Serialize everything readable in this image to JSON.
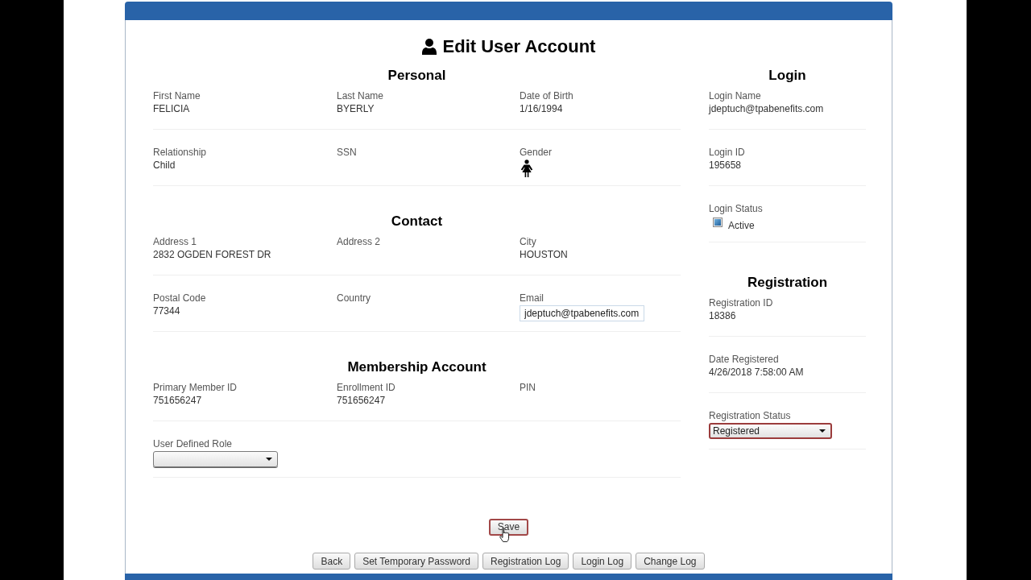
{
  "title": "Edit User Account",
  "main_sections": [
    {
      "heading": "Personal",
      "rows": [
        [
          {
            "label": "First Name",
            "kind": "text",
            "value": "FELICIA"
          },
          {
            "label": "Last Name",
            "kind": "text",
            "value": "BYERLY"
          },
          {
            "label": "Date of Birth",
            "kind": "text",
            "value": "1/16/1994"
          }
        ],
        [
          {
            "label": "Relationship",
            "kind": "text",
            "value": "Child"
          },
          {
            "label": "SSN",
            "kind": "text"
          },
          {
            "label": "Gender",
            "kind": "gender_icon"
          }
        ]
      ]
    },
    {
      "heading": "Contact",
      "rows": [
        [
          {
            "label": "Address 1",
            "kind": "text",
            "value": "2832 OGDEN FOREST DR"
          },
          {
            "label": "Address 2",
            "kind": "text"
          },
          {
            "label": "City",
            "kind": "text",
            "value": "HOUSTON"
          }
        ],
        [
          {
            "label": "Postal Code",
            "kind": "text",
            "value": "77344"
          },
          {
            "label": "Country",
            "kind": "text"
          },
          {
            "label": "Email",
            "kind": "input",
            "value": "jdeptuch@tpabenefits.com"
          }
        ]
      ]
    },
    {
      "heading": "Membership Account",
      "rows": [
        [
          {
            "label": "Primary Member ID",
            "kind": "text",
            "value": "751656247"
          },
          {
            "label": "Enrollment ID",
            "kind": "text",
            "value": "751656247"
          },
          {
            "label": "PIN",
            "kind": "text"
          }
        ],
        [
          {
            "label": "User Defined Role",
            "kind": "select",
            "focused": false
          }
        ]
      ]
    }
  ],
  "side_sections": [
    {
      "heading": "Login",
      "rows": [
        [
          {
            "label": "Login Name",
            "kind": "text",
            "value": "jdeptuch@tpabenefits.com"
          }
        ],
        [
          {
            "label": "Login ID",
            "kind": "text",
            "value": "195658"
          }
        ],
        [
          {
            "label": "Login Status",
            "kind": "checkbox",
            "checked": true,
            "option": "Active"
          }
        ]
      ]
    },
    {
      "heading": "Registration",
      "rows": [
        [
          {
            "label": "Registration ID",
            "kind": "text",
            "value": "18386"
          }
        ],
        [
          {
            "label": "Date Registered",
            "kind": "text",
            "value": "4/26/2018 7:58:00 AM"
          }
        ],
        [
          {
            "label": "Registration Status",
            "kind": "select",
            "value": "Registered",
            "focused": true
          }
        ]
      ]
    }
  ],
  "save_button": {
    "label": "Save",
    "focused": true
  },
  "buttons": [
    {
      "label": "Back",
      "focused": false
    },
    {
      "label": "Set Temporary Password",
      "focused": false
    },
    {
      "label": "Registration Log",
      "focused": false
    },
    {
      "label": "Login Log",
      "focused": false
    },
    {
      "label": "Change Log",
      "focused": false
    }
  ]
}
